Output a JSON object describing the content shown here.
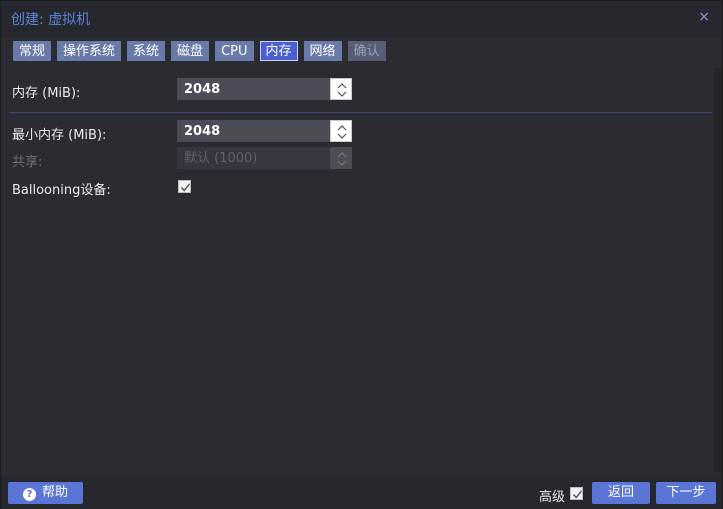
{
  "dialog": {
    "title": "创建: 虚拟机",
    "close_glyph": "×"
  },
  "tabs": [
    {
      "label": "常规",
      "state": "normal"
    },
    {
      "label": "操作系统",
      "state": "normal"
    },
    {
      "label": "系统",
      "state": "normal"
    },
    {
      "label": "磁盘",
      "state": "normal"
    },
    {
      "label": "CPU",
      "state": "normal"
    },
    {
      "label": "内存",
      "state": "active"
    },
    {
      "label": "网络",
      "state": "normal"
    },
    {
      "label": "确认",
      "state": "disabled"
    }
  ],
  "memory": {
    "memory_label": "内存 (MiB):",
    "memory_value": "2048",
    "min_memory_label": "最小内存 (MiB):",
    "min_memory_value": "2048",
    "shares_label": "共享:",
    "shares_placeholder": "默认 (1000)",
    "ballooning_label": "Ballooning设备:",
    "ballooning_checked": true
  },
  "footer": {
    "help_label": "帮助",
    "advanced_label": "高级",
    "advanced_checked": true,
    "back_label": "返回",
    "next_label": "下一步"
  },
  "colors": {
    "accent": "#5b75d6",
    "tab": "#6a7aa8",
    "title": "#5b86d6"
  }
}
